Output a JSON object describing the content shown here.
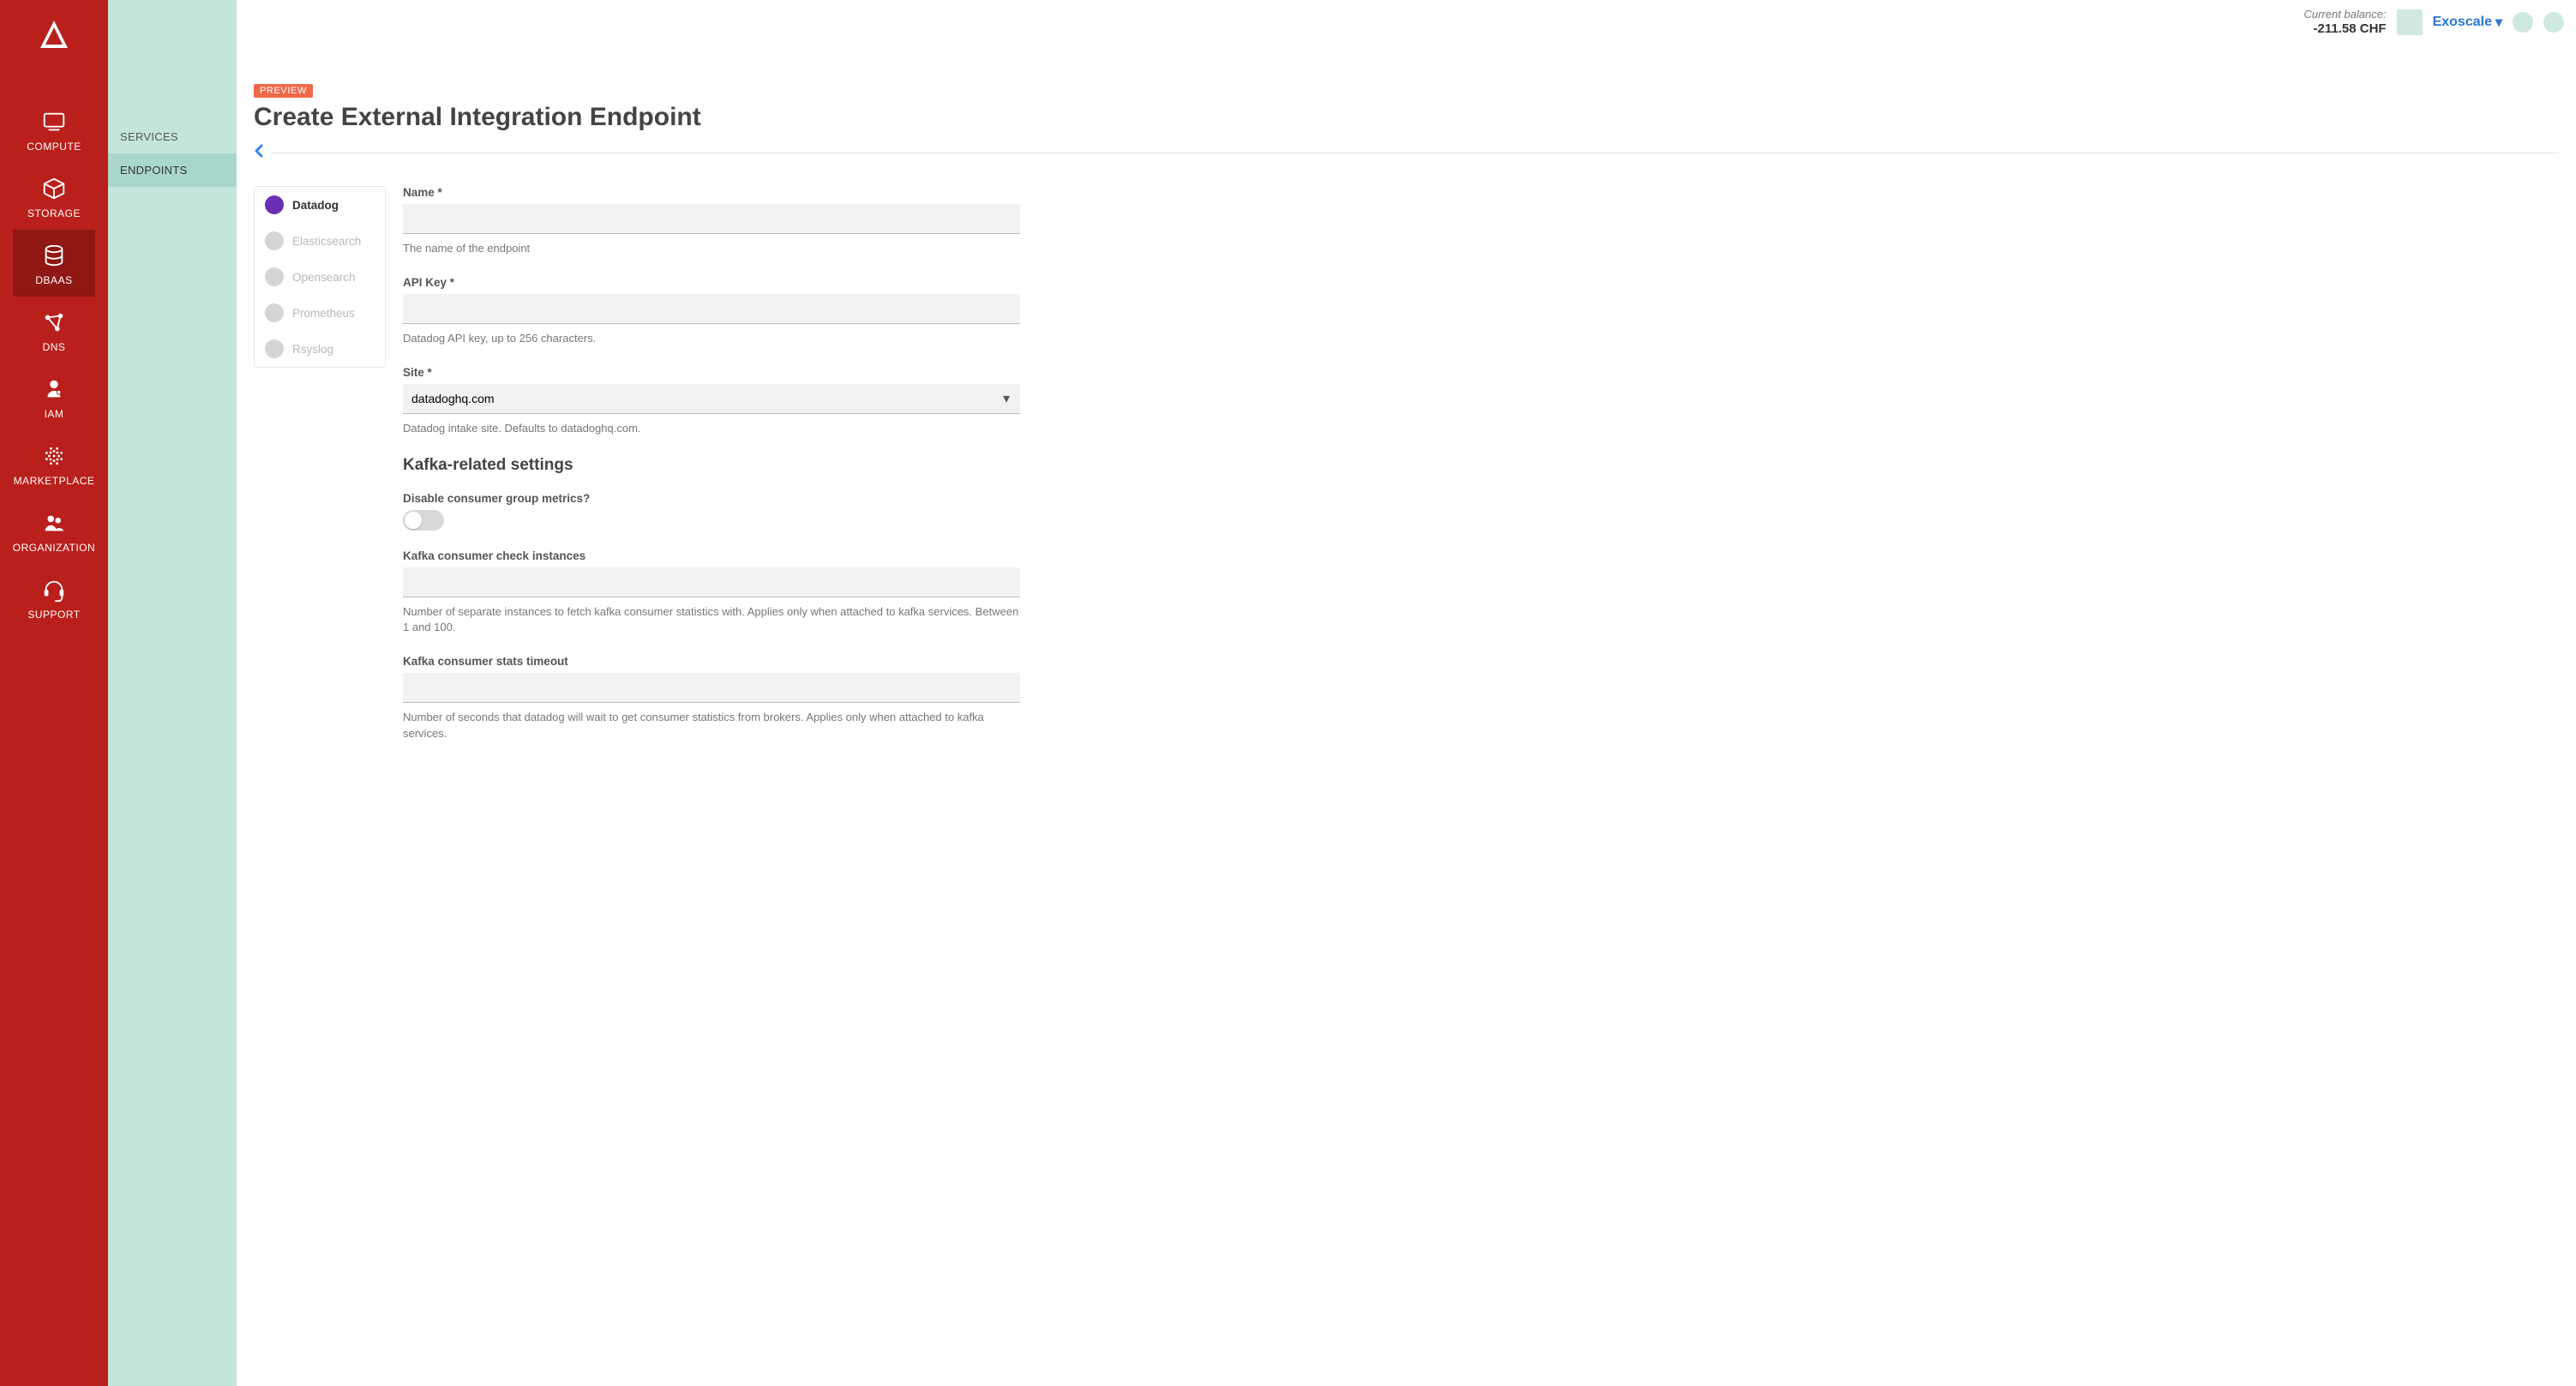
{
  "topbar": {
    "balance_label": "Current balance:",
    "balance_value": "-211.58 CHF",
    "org_name": "Exoscale"
  },
  "primary_nav": {
    "items": [
      {
        "label": "COMPUTE",
        "icon": "monitor-icon"
      },
      {
        "label": "STORAGE",
        "icon": "cube-icon"
      },
      {
        "label": "DBAAS",
        "icon": "database-icon"
      },
      {
        "label": "DNS",
        "icon": "network-icon"
      },
      {
        "label": "IAM",
        "icon": "user-key-icon"
      },
      {
        "label": "MARKETPLACE",
        "icon": "dots-icon"
      },
      {
        "label": "ORGANIZATION",
        "icon": "people-icon"
      },
      {
        "label": "SUPPORT",
        "icon": "headset-icon"
      }
    ],
    "active_index": 2
  },
  "secondary_nav": {
    "items": [
      "SERVICES",
      "ENDPOINTS"
    ],
    "active_index": 1
  },
  "page": {
    "badge": "PREVIEW",
    "title": "Create External Integration Endpoint"
  },
  "tabs": {
    "items": [
      "Datadog",
      "Elasticsearch",
      "Opensearch",
      "Prometheus",
      "Rsyslog"
    ],
    "active_index": 0
  },
  "form": {
    "name": {
      "label": "Name *",
      "value": "",
      "help": "The name of the endpoint"
    },
    "api_key": {
      "label": "API Key *",
      "value": "",
      "help": "Datadog API key, up to 256 characters."
    },
    "site": {
      "label": "Site *",
      "value": "datadoghq.com",
      "help": "Datadog intake site. Defaults to datadoghq.com."
    },
    "kafka_section_title": "Kafka-related settings",
    "disable_consumer": {
      "label": "Disable consumer group metrics?",
      "value": false
    },
    "check_instances": {
      "label": "Kafka consumer check instances",
      "value": "",
      "help": "Number of separate instances to fetch kafka consumer statistics with. Applies only when attached to kafka services. Between 1 and 100."
    },
    "stats_timeout": {
      "label": "Kafka consumer stats timeout",
      "value": "",
      "help": "Number of seconds that datadog will wait to get consumer statistics from brokers. Applies only when attached to kafka services."
    }
  }
}
